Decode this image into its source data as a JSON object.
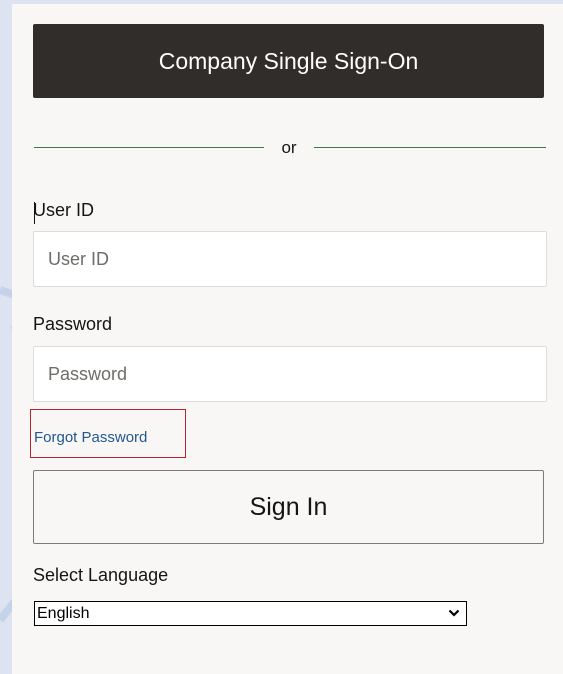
{
  "sso": {
    "label": "Company Single Sign-On"
  },
  "divider": {
    "text": "or"
  },
  "user_id": {
    "label": "User ID",
    "placeholder": "User ID",
    "value": ""
  },
  "password": {
    "label": "Password",
    "placeholder": "Password",
    "value": ""
  },
  "forgot": {
    "label": "Forgot Password"
  },
  "signin": {
    "label": "Sign In"
  },
  "language": {
    "label": "Select Language",
    "selected": "English",
    "icon": "chevron-down-icon"
  },
  "colors": {
    "sso_bg": "#312d2a",
    "divider_line": "#3d7a46",
    "link": "#23588f",
    "focus_outline": "#b8232f",
    "panel_bg": "#f8f7f6"
  }
}
